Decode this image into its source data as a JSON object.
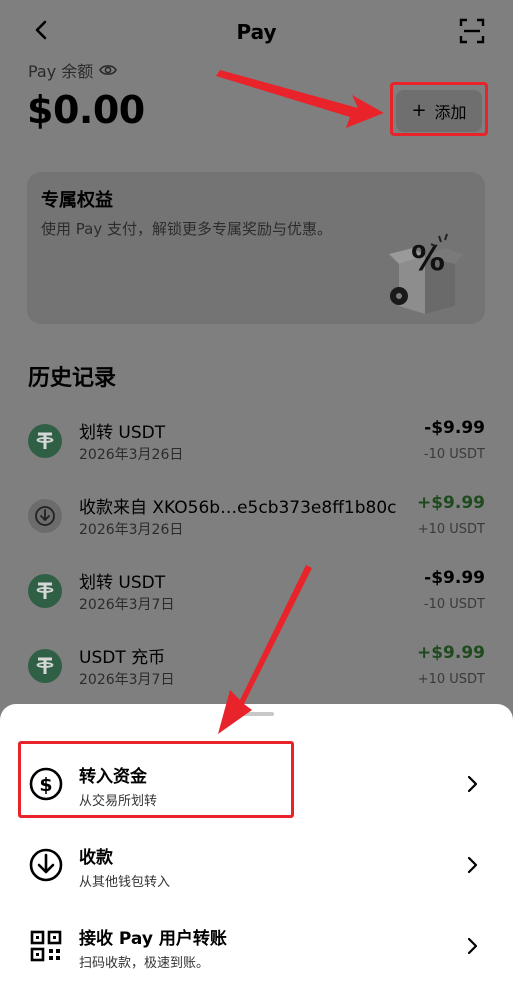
{
  "header": {
    "title": "Pay"
  },
  "balance": {
    "label": "Pay 余额",
    "amount": "$0.00"
  },
  "add_button": {
    "label": "添加"
  },
  "benefit": {
    "title": "专属权益",
    "description": "使用 Pay 支付，解锁更多专属奖励与优惠。"
  },
  "history": {
    "title": "历史记录",
    "items": [
      {
        "name": "划转 USDT",
        "date": "2026年3月26日",
        "amount": "-$9.99",
        "sub": "-10 USDT",
        "icon": "tether-icon"
      },
      {
        "name": "收款来自 XKO56b…e5cb373e8ff1b80c",
        "date": "2026年3月26日",
        "amount": "+$9.99",
        "sub": "+10 USDT",
        "icon": "receive-icon"
      },
      {
        "name": "划转 USDT",
        "date": "2026年3月7日",
        "amount": "-$9.99",
        "sub": "-10 USDT",
        "icon": "tether-icon"
      },
      {
        "name": "USDT 充币",
        "date": "2026年3月7日",
        "amount": "+$9.99",
        "sub": "+10 USDT",
        "icon": "tether-icon"
      }
    ]
  },
  "sheet": {
    "options": [
      {
        "title": "转入资金",
        "subtitle": "从交易所划转",
        "icon": "dollar-circle-icon"
      },
      {
        "title": "收款",
        "subtitle": "从其他钱包转入",
        "icon": "download-circle-icon"
      },
      {
        "title": "接收 Pay 用户转账",
        "subtitle": "扫码收款，极速到账。",
        "icon": "qr-code-icon"
      }
    ]
  },
  "colors": {
    "highlight": "#e8232a",
    "positive": "#1e4a1e",
    "tether": "#2f5f45"
  }
}
